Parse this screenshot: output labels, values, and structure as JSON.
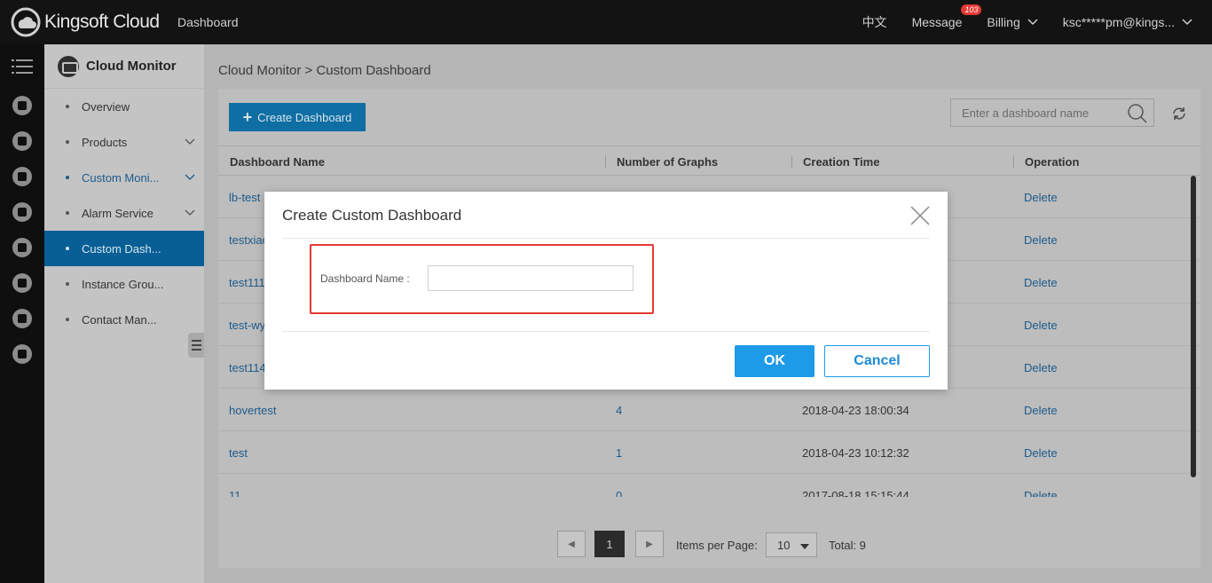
{
  "topbar": {
    "brand": "Kingsoft Cloud",
    "nav_dashboard": "Dashboard",
    "lang": "中文",
    "message": "Message",
    "message_count": "103",
    "billing": "Billing",
    "account": "ksc*****pm@kings..."
  },
  "sidebar": {
    "title": "Cloud Monitor",
    "items": [
      {
        "label": "Overview"
      },
      {
        "label": "Products"
      },
      {
        "label": "Custom Moni..."
      },
      {
        "label": "Alarm Service"
      },
      {
        "label": "Custom Dash..."
      },
      {
        "label": "Instance Grou..."
      },
      {
        "label": "Contact Man..."
      }
    ]
  },
  "main": {
    "breadcrumb": "Cloud Monitor > Custom Dashboard",
    "create_button": "Create Dashboard",
    "search_placeholder": "Enter a dashboard name",
    "columns": [
      "Dashboard Name",
      "Number of Graphs",
      "Creation Time",
      "Operation"
    ],
    "rows": [
      {
        "name": "lb-test",
        "graphs": "",
        "time": "",
        "op": "Delete"
      },
      {
        "name": "testxiao",
        "graphs": "",
        "time": "",
        "op": "Delete"
      },
      {
        "name": "test111",
        "graphs": "",
        "time": "",
        "op": "Delete"
      },
      {
        "name": "test-wy",
        "graphs": "",
        "time": "",
        "op": "Delete"
      },
      {
        "name": "test114",
        "graphs": "",
        "time": "",
        "op": "Delete"
      },
      {
        "name": "hovertest",
        "graphs": "4",
        "time": "2018-04-23 18:00:34",
        "op": "Delete"
      },
      {
        "name": "test",
        "graphs": "1",
        "time": "2018-04-23 10:12:32",
        "op": "Delete"
      },
      {
        "name": "11",
        "graphs": "0",
        "time": "2017-08-18 15:15:44",
        "op": "Delete"
      }
    ],
    "pager": {
      "current_page": "1",
      "items_per_page_label": "Items per Page:",
      "items_per_page": "10",
      "total": "Total: 9"
    }
  },
  "modal": {
    "title": "Create Custom Dashboard",
    "field_label": "Dashboard Name :",
    "field_value": "",
    "ok": "OK",
    "cancel": "Cancel",
    "highlight_color": "#e53935"
  }
}
